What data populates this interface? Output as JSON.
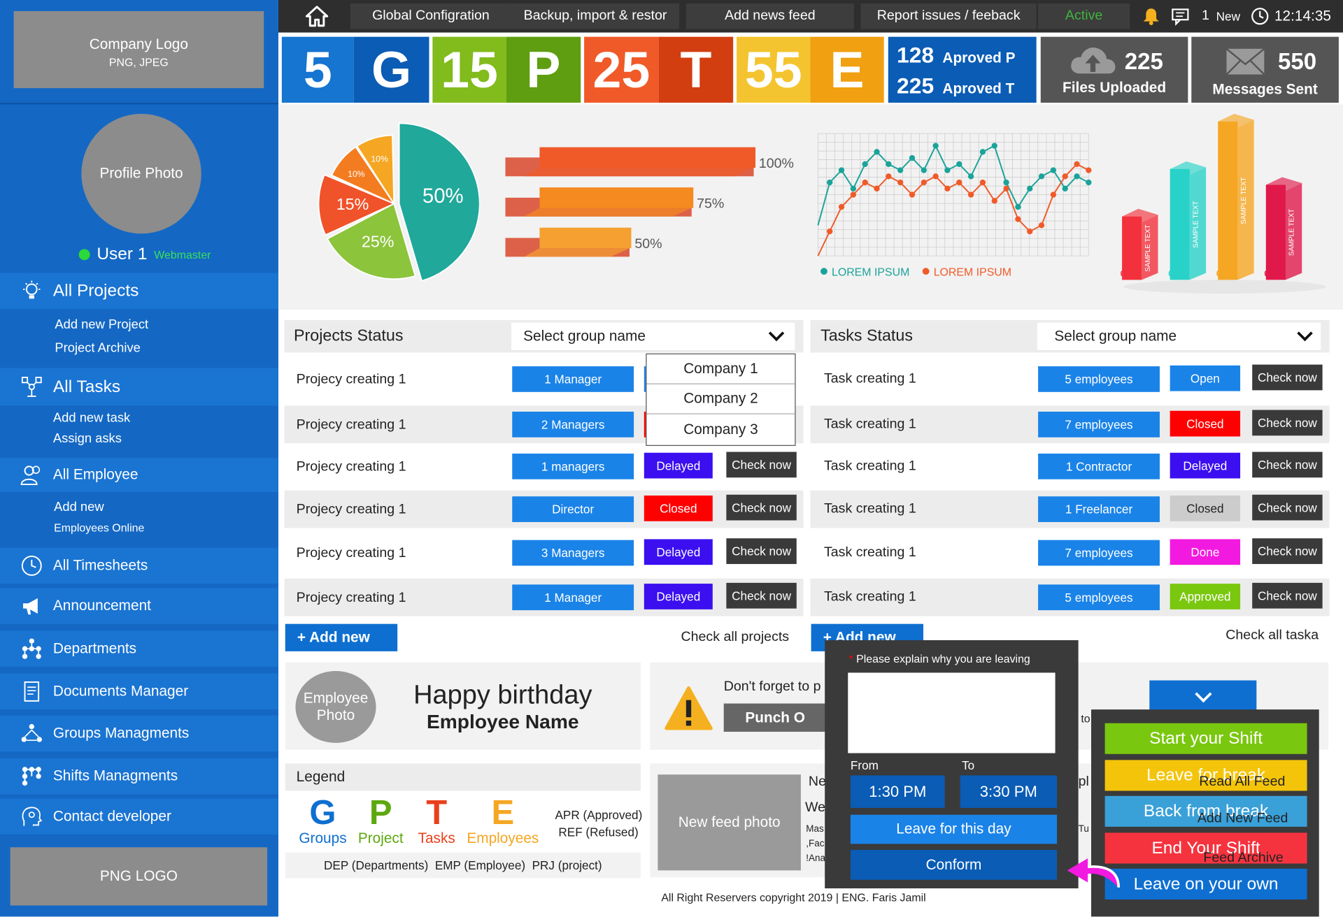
{
  "sidebar": {
    "logo_title": "Company Logo",
    "logo_sub": "PNG, JPEG",
    "profile_photo": "Profile Photo",
    "user_name": "User 1",
    "user_role": "Webmaster",
    "items": [
      {
        "label": "All Projects",
        "icon": "lightbulb-icon",
        "subs": [
          "Add new Project",
          "Project Archive"
        ]
      },
      {
        "label": "All Tasks",
        "icon": "tasks-network-icon",
        "subs": [
          "Add new task",
          "Assign asks"
        ]
      },
      {
        "label": "All Employee",
        "icon": "users-icon",
        "subs": [
          "Add new",
          "Employees Online"
        ]
      },
      {
        "label": "All Timesheets",
        "icon": "clock-icon",
        "subs": []
      },
      {
        "label": "Announcement",
        "icon": "megaphone-icon",
        "subs": []
      },
      {
        "label": "Departments",
        "icon": "org-chart-icon",
        "subs": []
      },
      {
        "label": "Documents Manager",
        "icon": "document-icon",
        "subs": []
      },
      {
        "label": "Groups Managments",
        "icon": "group-icon",
        "subs": []
      },
      {
        "label": "Shifts Managments",
        "icon": "shift-grid-icon",
        "subs": []
      },
      {
        "label": "Contact developer",
        "icon": "head-gear-icon",
        "subs": []
      }
    ],
    "png_logo": "PNG LOGO"
  },
  "topbar": {
    "nav": [
      "Global Configration",
      "Backup, import & restor",
      "Add news feed",
      "Report issues / feeback"
    ],
    "status": "Active",
    "new_count": "1",
    "new_label": "New",
    "time": "12:14:35"
  },
  "stats": {
    "tiles": [
      {
        "num": "5",
        "letter": "G"
      },
      {
        "num": "15",
        "letter": "P"
      },
      {
        "num": "25",
        "letter": "T"
      },
      {
        "num": "55",
        "letter": "E"
      }
    ],
    "approved": [
      {
        "num": "128",
        "label": "Aproved P"
      },
      {
        "num": "225",
        "label": "Aproved T"
      }
    ],
    "files": {
      "num": "225",
      "label": "Files Uploaded"
    },
    "messages": {
      "num": "550",
      "label": "Messages Sent"
    }
  },
  "chart_data": [
    {
      "type": "pie",
      "values": [
        50,
        25,
        15,
        10,
        10
      ],
      "labels": [
        "50%",
        "25%",
        "15%",
        "10%",
        "10%"
      ],
      "colors": [
        "#20a89a",
        "#8cc43c",
        "#f0522a",
        "#f47c20",
        "#f5a623"
      ]
    },
    {
      "type": "bar",
      "orientation": "horizontal",
      "values": [
        100,
        75,
        50
      ],
      "labels": [
        "100%",
        "75%",
        "50%"
      ],
      "colors": [
        "#f05a28",
        "#f48a20",
        "#f5a030"
      ]
    },
    {
      "type": "line",
      "series": [
        {
          "name": "LOREM IPSUM",
          "color": "#1aa39a",
          "values": [
            5,
            12,
            14,
            11,
            15,
            17,
            15,
            14,
            16,
            14,
            18,
            14,
            15,
            13,
            17,
            18,
            12,
            8,
            11,
            13,
            14,
            11,
            13,
            12
          ]
        },
        {
          "name": "LOREM IPSUM",
          "color": "#f05a28",
          "values": [
            0,
            4,
            8,
            10,
            12,
            11,
            13,
            12,
            10,
            12,
            13,
            11,
            12,
            10,
            12,
            9,
            11,
            6,
            4,
            5,
            10,
            13,
            15,
            14
          ]
        }
      ],
      "grid": true
    },
    {
      "type": "bar",
      "style": "3d",
      "categories": [
        "01",
        "01",
        "01",
        "01"
      ],
      "values": [
        40,
        70,
        100,
        60
      ],
      "labels": [
        "SAMPLE TEXT",
        "SAMPLE TEXT",
        "SAMPLE TEXT",
        "SAMPLE TEXT"
      ],
      "colors": [
        "#f2313c",
        "#28d2c8",
        "#f5a623",
        "#e0194a"
      ]
    }
  ],
  "projects": {
    "title": "Projects Status",
    "select": "Select group name",
    "dropdown": [
      "Company 1",
      "Company 2",
      "Company 3"
    ],
    "rows": [
      {
        "name": "Projecy creating 1",
        "who": "1 Manager",
        "status": "",
        "check": ""
      },
      {
        "name": "Projecy creating 1",
        "who": "2 Managers",
        "status": "",
        "check": ""
      },
      {
        "name": "Projecy creating 1",
        "who": "1 managers",
        "status": "Delayed",
        "check": "Check now"
      },
      {
        "name": "Projecy creating 1",
        "who": "Director",
        "status": "Closed",
        "check": "Check now"
      },
      {
        "name": "Projecy creating 1",
        "who": "3 Managers",
        "status": "Delayed",
        "check": "Check now"
      },
      {
        "name": "Projecy creating 1",
        "who": "1 Manager",
        "status": "Delayed",
        "check": "Check now"
      }
    ],
    "add": "+ Add new",
    "check_all": "Check all projects"
  },
  "tasks": {
    "title": "Tasks Status",
    "select": "Select group name",
    "rows": [
      {
        "name": "Task creating 1",
        "who": "5 employees",
        "status": "Open",
        "check": "Check now"
      },
      {
        "name": "Task creating 1",
        "who": "7 employees",
        "status": "Closed",
        "check": "Check now"
      },
      {
        "name": "Task creating 1",
        "who": "1 Contractor",
        "status": "Delayed",
        "check": "Check now"
      },
      {
        "name": "Task creating 1",
        "who": "1 Freelancer",
        "status": "Closed",
        "check": "Check now"
      },
      {
        "name": "Task creating 1",
        "who": "7 employees",
        "status": "Done",
        "check": "Check now"
      },
      {
        "name": "Task creating 1",
        "who": "5 employees",
        "status": "Approved",
        "check": "Check now"
      }
    ],
    "add": "+ Add new",
    "check_all": "Check all taska"
  },
  "birthday": {
    "photo": "Employee Photo",
    "line1": "Happy birthday",
    "line2": "Employee Name"
  },
  "reminder": {
    "text": "Don't forget to p",
    "button": "Punch O",
    "frag": "to"
  },
  "legend": {
    "title": "Legend",
    "letters": [
      {
        "letter": "G",
        "word": "Groups",
        "color": "#0e6fd1"
      },
      {
        "letter": "P",
        "word": "Project",
        "color": "#5ea80f"
      },
      {
        "letter": "T",
        "word": "Tasks",
        "color": "#e8401c"
      },
      {
        "letter": "E",
        "word": "Employees",
        "color": "#f5a623"
      }
    ],
    "apr": "APR (Approved)",
    "ref": "REF (Refused)",
    "abbr": "DEP (Departments)  EMP (Employee)  PRJ (project)"
  },
  "news": {
    "photo": "New feed photo",
    "f1": "Ne",
    "f2": "We",
    "f3": "Mas",
    "f4": ",Fac",
    "f5": "!Ana",
    "g1": "pl",
    "g2": "Tu"
  },
  "leave": {
    "prompt": "Please explain why you are leaving",
    "from_label": "From",
    "to_label": "To",
    "from": "1:30 PM",
    "to": "3:30 PM",
    "day_btn": "Leave for this day",
    "confirm": "Conform"
  },
  "shift": {
    "buttons": [
      "Start your Shift",
      "Leave for break",
      "Back from break",
      "End Your Shift",
      "Leave on your own"
    ],
    "overlaps": [
      "Read All Feed",
      "Add New Feed",
      "Feed Archive"
    ]
  },
  "footer": "All Right Reservers copyright 2019 | ENG. Faris Jamil"
}
